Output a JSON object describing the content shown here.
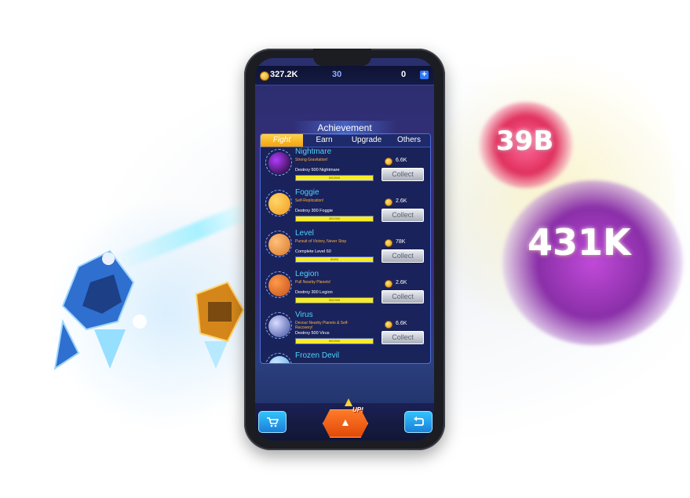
{
  "background": {
    "score_a": "39B",
    "score_b": "431K"
  },
  "topbar": {
    "coins": "327.2K",
    "counter_mid": "30",
    "gems": "0",
    "plus_label": "+",
    "coin_icon": "coin-icon"
  },
  "panel": {
    "title": "Achievement",
    "tabs": [
      {
        "label": "Fight",
        "active": true
      },
      {
        "label": "Earn",
        "active": false
      },
      {
        "label": "Upgrade",
        "active": false
      },
      {
        "label": "Others",
        "active": false
      }
    ]
  },
  "achievements": [
    {
      "name": "Nightmare",
      "subtitle": "Strong Gravitation!",
      "task": "Destroy 500 Nightmare",
      "progress_label": "500/500",
      "progress": 1.0,
      "reward": "6.6K",
      "button": "Collect",
      "planet_color": "#1a0620",
      "planet_accent": "#b03cff"
    },
    {
      "name": "Foggie",
      "subtitle": "Self-Replication!",
      "task": "Destroy 300 Foggie",
      "progress_label": "300/300",
      "progress": 1.0,
      "reward": "2.6K",
      "button": "Collect",
      "planet_color": "#f29a1a",
      "planet_accent": "#ffd66a"
    },
    {
      "name": "Level",
      "subtitle": "Pursuit of Victory, Never Stop",
      "task": "Complete Level 60",
      "progress_label": "60/60",
      "progress": 1.0,
      "reward": "78K",
      "button": "Collect",
      "planet_color": "#d9782a",
      "planet_accent": "#ffc07a"
    },
    {
      "name": "Legion",
      "subtitle": "Pull Nearby Planets!",
      "task": "Destroy 300 Legion",
      "progress_label": "300/300",
      "progress": 1.0,
      "reward": "2.6K",
      "button": "Collect",
      "planet_color": "#c4501a",
      "planet_accent": "#ff9a4a"
    },
    {
      "name": "Virus",
      "subtitle": "Devour Nearby Planets & Self-Recovery!",
      "task": "Destroy 500 Virus",
      "progress_label": "500/500",
      "progress": 1.0,
      "reward": "6.6K",
      "button": "Collect",
      "planet_color": "#3a4c9e",
      "planet_accent": "#d8dcff"
    },
    {
      "name": "Frozen Devil",
      "subtitle": "",
      "task": "",
      "progress_label": "",
      "progress": 0,
      "reward": "",
      "button": "",
      "planet_color": "#5aa8e8",
      "planet_accent": "#cdeaff"
    }
  ],
  "bottombar": {
    "shop_icon": "cart-icon",
    "up_label": "UP!",
    "back_icon": "return-icon"
  },
  "colors": {
    "accent_blue": "#4fd3ff",
    "accent_orange": "#ffb13a",
    "progress_yellow": "#f6ec2a",
    "tab_active": "#f2a10f"
  }
}
